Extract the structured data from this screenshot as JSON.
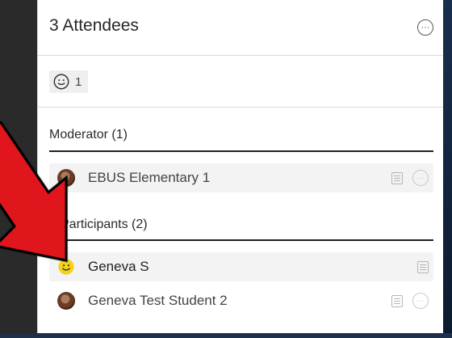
{
  "header": {
    "title": "3 Attendees",
    "more_icon": "more-options-icon"
  },
  "status": {
    "count": "1",
    "icon": "smile-icon"
  },
  "sections": {
    "moderator": {
      "title": "Moderator (1)"
    },
    "participants": {
      "title": "Participants (2)"
    }
  },
  "rows": {
    "mod0": {
      "name": "EBUS Elementary 1"
    },
    "p0": {
      "name": "Geneva S"
    },
    "p1": {
      "name": "Geneva Test Student 2"
    }
  },
  "colors": {
    "accent_arrow": "#e0141b",
    "emoji_yellow": "#f2d21b",
    "panel_bg": "#ffffff"
  }
}
